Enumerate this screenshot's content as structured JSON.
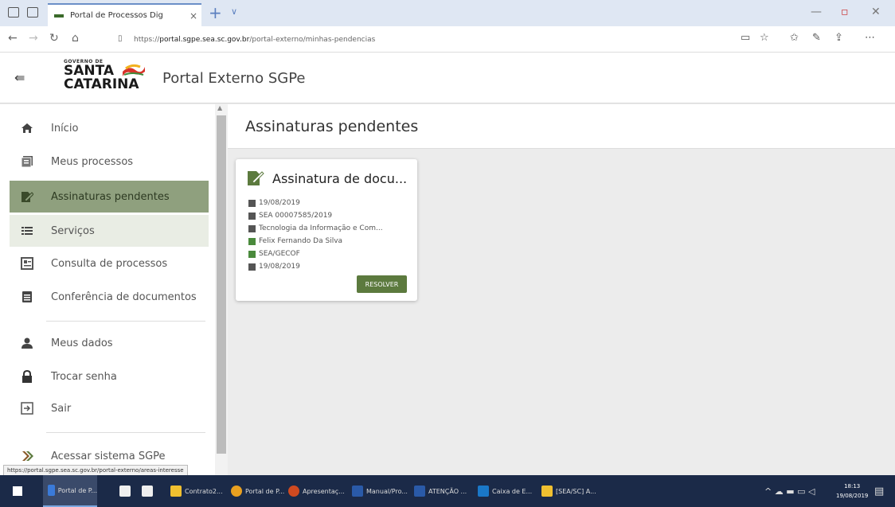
{
  "browser": {
    "tab_title": "Portal de Processos Dig",
    "tab_close": "×",
    "new_tab": "+",
    "tab_menu": "∨",
    "url_prefix": "https://",
    "url_host": "portal.sgpe.sea.sc.gov.br",
    "url_path": "/portal-externo/minhas-pendencias"
  },
  "header": {
    "logo_gov": "GOVERNO DE",
    "logo_line1": "SANTA",
    "logo_line2": "CATARINA",
    "title": "Portal Externo SGPe"
  },
  "sidebar": {
    "items": [
      {
        "label": "Início",
        "icon": "home-icon"
      },
      {
        "label": "Meus processos",
        "icon": "folder-icon"
      },
      {
        "label": "Assinaturas pendentes",
        "icon": "signature-icon"
      },
      {
        "label": "Serviços",
        "icon": "list-icon"
      },
      {
        "label": "Consulta de processos",
        "icon": "search-doc-icon"
      },
      {
        "label": "Conferência de documentos",
        "icon": "document-icon"
      },
      {
        "label": "Meus dados",
        "icon": "user-icon"
      },
      {
        "label": "Trocar senha",
        "icon": "lock-icon"
      },
      {
        "label": "Sair",
        "icon": "logout-icon"
      },
      {
        "label": "Acessar sistema SGPe",
        "icon": "sgpe-icon"
      }
    ]
  },
  "main": {
    "page_title": "Assinaturas pendentes",
    "card": {
      "title": "Assinatura de docu...",
      "date": "19/08/2019",
      "process": "SEA 00007585/2019",
      "subject": "Tecnologia da Informação e Com...",
      "person": "Felix Fernando Da Silva",
      "unit": "SEA/GECOF",
      "deadline": "19/08/2019",
      "action": "RESOLVER"
    }
  },
  "statusbar": "https://portal.sgpe.sea.sc.gov.br/portal-externo/areas-interesse",
  "taskbar": {
    "items": [
      "Portal de P...",
      "Contrato2...",
      "Portal de P...",
      "Apresentaç...",
      "Manual/Pro...",
      "ATENÇÃO ...",
      "Caixa de E...",
      "[SEA/SC] A..."
    ],
    "time": "18:13",
    "date": "19/08/2019"
  },
  "colors": {
    "accent": "#5c7a3e",
    "active_item": "#8fa07e"
  }
}
